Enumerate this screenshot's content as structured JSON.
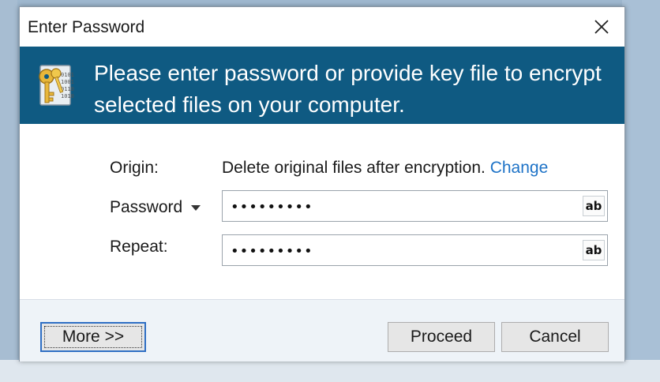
{
  "window": {
    "title": "Enter Password"
  },
  "banner": {
    "message": "Please enter password or provide key file to encrypt selected files on your computer."
  },
  "form": {
    "origin_label": "Origin:",
    "origin_value": "Delete original files after encryption.",
    "change_link": "Change",
    "password_label": "Password",
    "password_value": "•••••••••",
    "repeat_label": "Repeat:",
    "repeat_value": "•••••••••",
    "reveal_label": "ab"
  },
  "buttons": {
    "more": "More >>",
    "proceed": "Proceed",
    "cancel": "Cancel"
  },
  "icons": {
    "close": "close-icon",
    "banner": "keys-document-icon",
    "password_dropdown": "chevron-down-icon"
  },
  "colors": {
    "banner_bg": "#0f5a82",
    "link": "#1e73c7",
    "footer_bg": "#eef3f8",
    "focus_border": "#2f6fc4"
  }
}
